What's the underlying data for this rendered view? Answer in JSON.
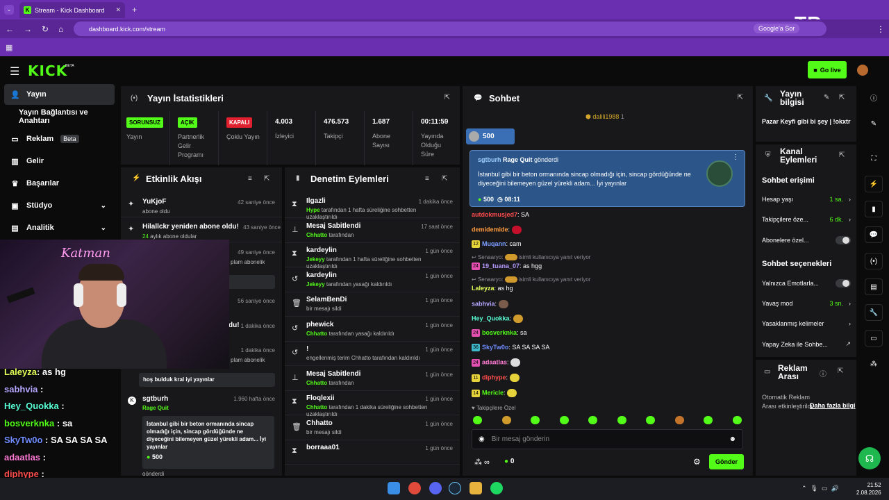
{
  "browser": {
    "tab_title": "Stream - Kick Dashboard",
    "url": "dashboard.kick.com/stream",
    "google_chip": "Google'a Sor",
    "overlay_logo": "TR"
  },
  "header": {
    "logo": "KICK",
    "logo_badge": "BETA",
    "go_live": "Go live"
  },
  "sidebar": {
    "items": [
      {
        "label": "Yayın"
      },
      {
        "label": "Yayın Bağlantısı ve Anahtarı"
      },
      {
        "label": "Reklam",
        "badge": "Beta"
      },
      {
        "label": "Gelir"
      },
      {
        "label": "Başarılar"
      },
      {
        "label": "Stüdyo"
      },
      {
        "label": "Analitik"
      }
    ]
  },
  "stats": {
    "title": "Yayın İstatistikleri",
    "items": [
      {
        "badge": "SORUNSUZ",
        "label": "Yayın"
      },
      {
        "badge": "AÇIK",
        "label": "Partnerlik Gelir Programı"
      },
      {
        "badge": "KAPALI",
        "label": "Çoklu Yayın"
      },
      {
        "value": "4.003",
        "label": "İzleyici"
      },
      {
        "value": "476.573",
        "label": "Takipçi"
      },
      {
        "value": "1.687",
        "label": "Abone Sayısı"
      },
      {
        "value": "00:11:59",
        "label": "Yayında Olduğu Süre"
      }
    ]
  },
  "activity": {
    "title": "Etkinlik Akışı",
    "rows": [
      {
        "name": "YuKjoF",
        "sub": "abone oldu",
        "time": "42 saniye önce"
      },
      {
        "name": "Hilallckr yeniden abone oldu!",
        "sub_green": "24",
        "sub": " aylık abone oldular",
        "time": "43 saniye önce"
      },
      {
        "time": "49 saniye önce",
        "sub": "plam abonelik"
      },
      {
        "time": "56 saniye önce"
      },
      {
        "name": "du!",
        "time": "1 dakika önce"
      },
      {
        "time": "1 dakika önce",
        "sub": "plam abonelik"
      },
      {
        "sub": "hoş bulduk kral iyi yayınlar"
      },
      {
        "name": "sgtburh",
        "sub_green": "Rage Quit",
        "time": "1.960 hafta önce",
        "quote": "İstanbul gibi bir beton ormanında sincap olmadığı için, sincap gördüğünde ne diyeceğini bilemeyen güzel yürekli adam... İyi yayınlar",
        "amount": "500",
        "tail": "gönderdi"
      }
    ]
  },
  "moderation": {
    "title": "Denetim Eylemleri",
    "rows": [
      {
        "name": "Ilgazli",
        "sub_green": "Hype",
        "sub": " tarafından 1 hafta süreliğine sohbetten uzaklaştırıldı",
        "time": "1 dakika önce",
        "icon": "hourglass-icon"
      },
      {
        "name": "Mesaj Sabitlendi",
        "sub_green": "Chhatto",
        "sub": " tarafından",
        "time": "17 saat önce",
        "icon": "pin-icon"
      },
      {
        "name": "kardeylin",
        "sub_green": "Jekeyy",
        "sub": " tarafından 1 hafta süreliğine sohbetten uzaklaştırıldı",
        "time": "1 gün önce",
        "icon": "hourglass-icon"
      },
      {
        "name": "kardeylin",
        "sub_green": "Jekeyy",
        "sub": " tarafından yasağı kaldırıldı",
        "time": "1 gün önce",
        "icon": "undo-icon"
      },
      {
        "name": "SelamBenDi",
        "sub": "bir mesajı sildi",
        "time": "1 gün önce",
        "icon": "trash-icon"
      },
      {
        "name": "phewick",
        "sub_green": "Chhatto",
        "sub": " tarafından yasağı kaldırıldı",
        "time": "1 gün önce",
        "icon": "undo-icon"
      },
      {
        "name": "!",
        "sub": "engellenmiş terim Chhatto tarafından kaldırıldı",
        "time": "1 gün önce",
        "icon": "undo-icon"
      },
      {
        "name": "Mesaj Sabitlendi",
        "sub_green": "Chhatto",
        "sub": " tarafından",
        "time": "1 gün önce",
        "icon": "pin-icon"
      },
      {
        "name": "Floqlexii",
        "sub_green": "Chhatto",
        "sub": " tarafından 1 dakika süreliğine sohbetten uzaklaştırıldı",
        "time": "1 gün önce",
        "icon": "hourglass-icon"
      },
      {
        "name": "Chhatto",
        "sub": "bir mesajı sildi",
        "time": "1 gün önce",
        "icon": "trash-icon"
      },
      {
        "name": "borraaa01",
        "time": "1 gün önce",
        "icon": "hourglass-icon"
      }
    ]
  },
  "chat": {
    "title": "Sohbet",
    "top_gifter": "dalili1988",
    "top_gifter_count": "1",
    "kicks_pill": "500",
    "pinned": {
      "user": "sgtburh",
      "action": "Rage Quit",
      "suffix": " gönderdi",
      "text": "İstanbul gibi bir beton ormanında sincap olmadığı için, sincap gördüğünde ne diyeceğini bilemeyen güzel yürekli adam... İyi yayınlar",
      "amount": "500",
      "timer": "08:11"
    },
    "messages": [
      {
        "user": "autdokmusjed7",
        "text": ": SA",
        "color": "#ff4d4d"
      },
      {
        "user": "demidemide",
        "text": ":",
        "color": "#ff9a3c",
        "emote": "#c4102a"
      },
      {
        "badge": "12",
        "user": "Muqann",
        "text": ": cam",
        "color": "#7b9dff"
      },
      {
        "reply": "Senaaryo: ",
        "reply_tail": " isimli kullanıcıya yanıt veriyor"
      },
      {
        "badge": "24",
        "user": "19_tuana_07",
        "text": ": as hgg",
        "color": "#b79bff"
      },
      {
        "reply": "Senaaryo: ",
        "reply_tail": " isimli kullanıcıya yanıt veriyor"
      },
      {
        "user": "Laleyza",
        "text": ": as hg",
        "color": "#e5ff5a"
      },
      {
        "user": "sabhvia",
        "text": ":",
        "color": "#b7a7ff",
        "emote": "#7a5c4d"
      },
      {
        "user": "Hey_Quokka",
        "text": ":",
        "color": "#58ffd5",
        "emote": "#d19a2c"
      },
      {
        "badge": "24",
        "user": "bosverknka",
        "text": ": sa",
        "color": "#53fc18"
      },
      {
        "badge": "36",
        "user": "SkyTw0o",
        "text": ": SA SA SA SA",
        "color": "#6f8dff"
      },
      {
        "badge": "24",
        "user": "adaatlas",
        "text": ":",
        "color": "#ff7bd5",
        "emote": "#ddd"
      },
      {
        "badge": "11",
        "user": "diphype",
        "text": ":",
        "color": "#ff4d4d",
        "emote": "#e6d23a"
      },
      {
        "badge": "14",
        "user": "Mericle",
        "text": ":",
        "color": "#53fc18",
        "emote": "#e6d23a"
      }
    ],
    "followers_only": "Takipçilere Özel",
    "input_placeholder": "Bir mesaj gönderin",
    "kicks_count": "0",
    "send": "Gönder"
  },
  "stream_info": {
    "title": "Yayın bilgisi",
    "text": "Pazar Keyfi gibi bi şey | !okxtr"
  },
  "channel_actions": {
    "title": "Kanal Eylemleri",
    "chat_access": "Sohbet erişimi",
    "rows1": [
      {
        "label": "Hesap yaşı",
        "value": "1 sa."
      },
      {
        "label": "Takipçilere öze...",
        "value": "6 dk."
      },
      {
        "label": "Abonelere özel...",
        "toggle": true
      }
    ],
    "chat_options": "Sohbet seçenekleri",
    "rows2": [
      {
        "label": "Yalnızca Emotlarla...",
        "toggle": true
      },
      {
        "label": "Yavaş mod",
        "value": "3 sn."
      },
      {
        "label": "Yasaklanmış kelimeler"
      },
      {
        "label": "Yapay Zeka ile Sohbe..."
      }
    ]
  },
  "ad_break": {
    "title": "Reklam Arası",
    "text": "Otomatik Reklam Arası etkinleştirildi.",
    "link": "Daha fazla bilgi"
  },
  "overlay_chat": [
    {
      "user": "Laleyza",
      "text": ": as hg",
      "color": "#e5ff5a"
    },
    {
      "user": "sabhvia",
      "text": " :",
      "color": "#b7a7ff"
    },
    {
      "user": "Hey_Quokka",
      "text": " :",
      "color": "#58ffd5"
    },
    {
      "user": "bosverknka",
      "text": " : sa",
      "color": "#53fc18"
    },
    {
      "user": "SkyTw0o",
      "text": " : SA SA SA SA",
      "color": "#6f8dff"
    },
    {
      "user": "adaatlas",
      "text": " :",
      "color": "#ff7bd5"
    },
    {
      "user": "diphype",
      "text": " :",
      "color": "#ff4d4d"
    },
    {
      "user": "Mericle",
      "text": " :",
      "color": "#53fc18"
    }
  ],
  "webcam": {
    "neon_text": "Katman"
  },
  "taskbar": {
    "time": "21:52",
    "date": "2.08.2026"
  },
  "colors": {
    "brand": "#53fc18",
    "browser": "#6a2fb0",
    "panel": "#18181b"
  }
}
